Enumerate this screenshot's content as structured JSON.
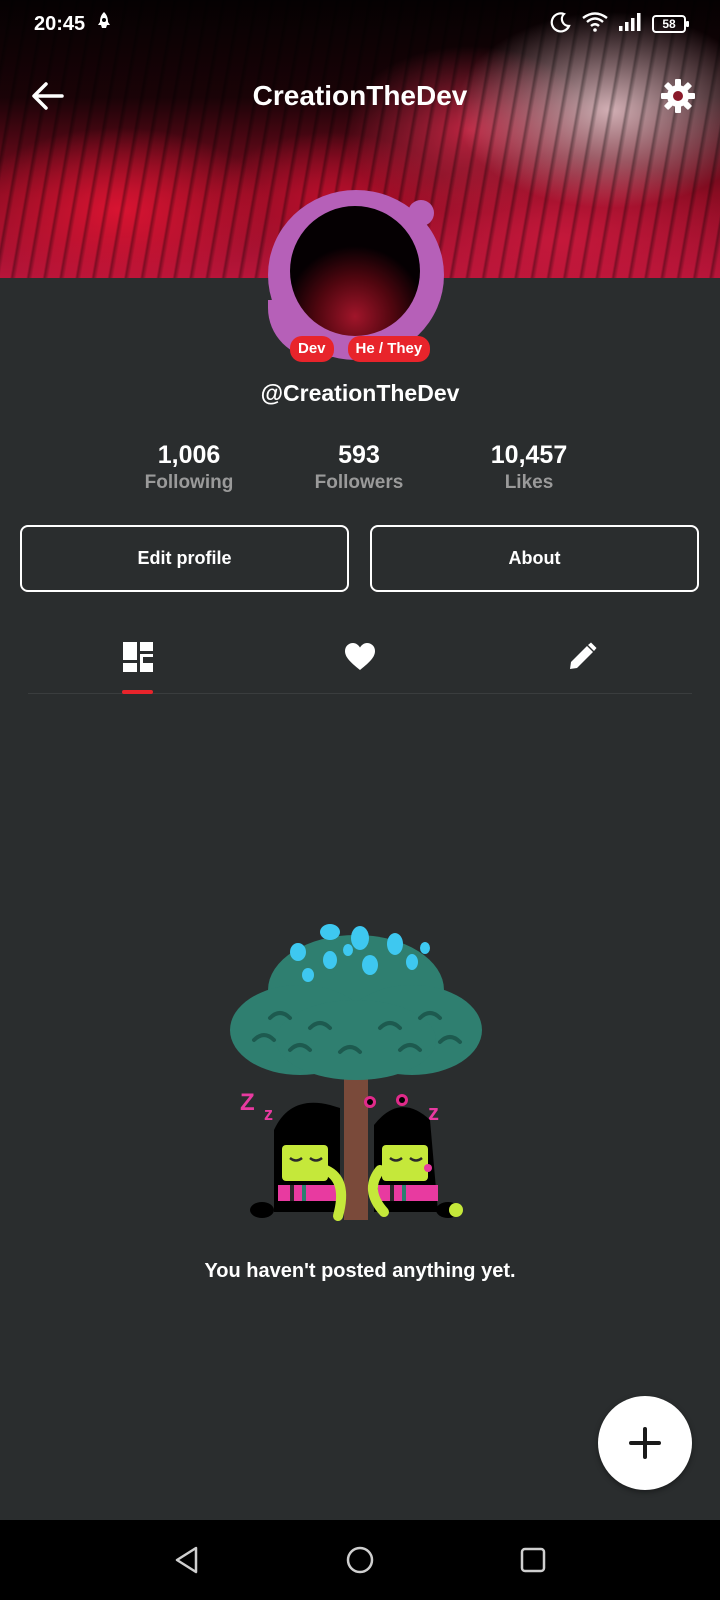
{
  "status_bar": {
    "time": "20:45",
    "battery": "58"
  },
  "header": {
    "title": "CreationTheDev"
  },
  "profile": {
    "badges": [
      "Dev",
      "He / They"
    ],
    "username": "@CreationTheDev"
  },
  "stats": [
    {
      "value": "1,006",
      "label": "Following"
    },
    {
      "value": "593",
      "label": "Followers"
    },
    {
      "value": "10,457",
      "label": "Likes"
    }
  ],
  "buttons": {
    "edit_profile": "Edit profile",
    "about": "About"
  },
  "tabs": [
    {
      "icon": "grid-icon",
      "active": true
    },
    {
      "icon": "heart-icon",
      "active": false
    },
    {
      "icon": "pencil-icon",
      "active": false
    }
  ],
  "empty_state": {
    "message": "You haven't posted anything yet."
  },
  "colors": {
    "accent": "#e8242b",
    "background": "#2a2d2e",
    "avatar_ring": "#b660b8"
  }
}
